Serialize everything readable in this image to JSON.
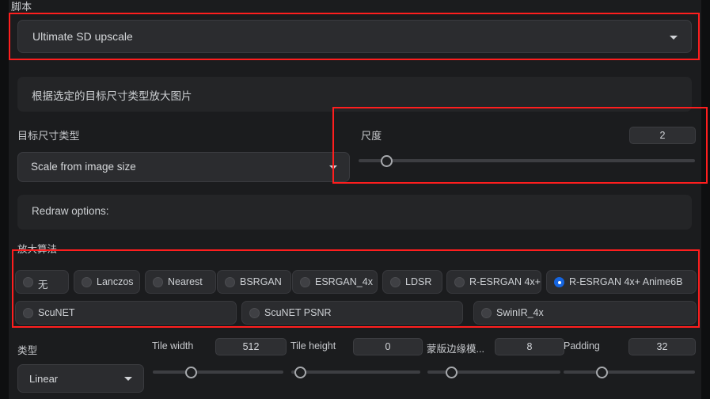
{
  "script": {
    "label": "脚本",
    "selected": "Ultimate SD upscale",
    "caret_icon": "chevron-down-icon"
  },
  "description": {
    "text": "根据选定的目标尺寸类型放大图片"
  },
  "target_size_type": {
    "label": "目标尺寸类型",
    "selected": "Scale from image size",
    "caret_icon": "chevron-down-icon"
  },
  "scale": {
    "label": "尺度",
    "value": "2",
    "slider_percent": 7
  },
  "redraw": {
    "text": "Redraw options:"
  },
  "upscaler": {
    "label": "放大算法",
    "options": [
      {
        "label": "无",
        "checked": false
      },
      {
        "label": "Lanczos",
        "checked": false
      },
      {
        "label": "Nearest",
        "checked": false
      },
      {
        "label": "BSRGAN",
        "checked": false
      },
      {
        "label": "ESRGAN_4x",
        "checked": false
      },
      {
        "label": "LDSR",
        "checked": false
      },
      {
        "label": "R-ESRGAN 4x+",
        "checked": false
      },
      {
        "label": "R-ESRGAN 4x+ Anime6B",
        "checked": true
      },
      {
        "label": "ScuNET",
        "checked": false
      },
      {
        "label": "ScuNET PSNR",
        "checked": false
      },
      {
        "label": "SwinIR_4x",
        "checked": false
      }
    ]
  },
  "type": {
    "label": "类型",
    "selected": "Linear",
    "caret_icon": "chevron-down-icon"
  },
  "tile_width": {
    "label": "Tile width",
    "value": "512",
    "slider_percent": 27
  },
  "tile_height": {
    "label": "Tile height",
    "value": "0",
    "slider_percent": 3
  },
  "mask_blur": {
    "label": "蒙版边缘模...",
    "value": "8",
    "slider_percent": 15
  },
  "padding": {
    "label": "Padding",
    "value": "32",
    "slider_percent": 27
  },
  "colors": {
    "accent_radio": "#1565e0",
    "annotation_red": "#ff1e1e",
    "panel_bg": "#242527",
    "control_bg": "#2b2c2f",
    "page_bg": "#1b1c1e"
  }
}
